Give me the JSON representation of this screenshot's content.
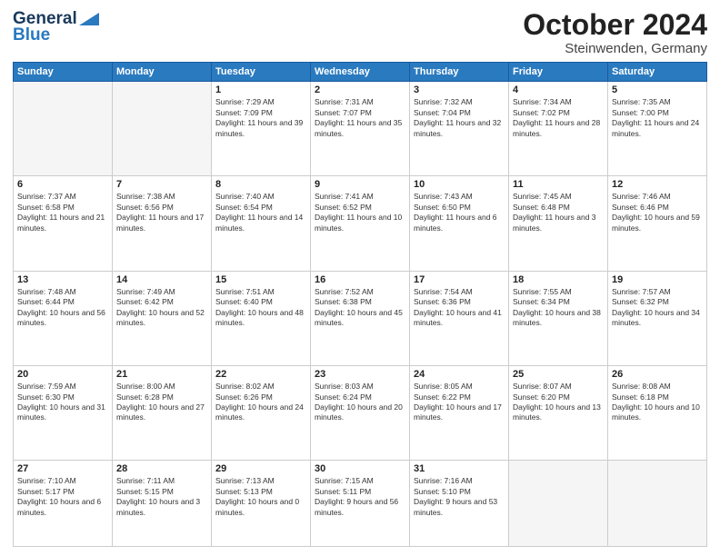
{
  "header": {
    "logo_line1": "General",
    "logo_line2": "Blue",
    "month": "October 2024",
    "location": "Steinwenden, Germany"
  },
  "days_of_week": [
    "Sunday",
    "Monday",
    "Tuesday",
    "Wednesday",
    "Thursday",
    "Friday",
    "Saturday"
  ],
  "weeks": [
    [
      {
        "day": "",
        "empty": true
      },
      {
        "day": "",
        "empty": true
      },
      {
        "day": "1",
        "sunrise": "Sunrise: 7:29 AM",
        "sunset": "Sunset: 7:09 PM",
        "daylight": "Daylight: 11 hours and 39 minutes."
      },
      {
        "day": "2",
        "sunrise": "Sunrise: 7:31 AM",
        "sunset": "Sunset: 7:07 PM",
        "daylight": "Daylight: 11 hours and 35 minutes."
      },
      {
        "day": "3",
        "sunrise": "Sunrise: 7:32 AM",
        "sunset": "Sunset: 7:04 PM",
        "daylight": "Daylight: 11 hours and 32 minutes."
      },
      {
        "day": "4",
        "sunrise": "Sunrise: 7:34 AM",
        "sunset": "Sunset: 7:02 PM",
        "daylight": "Daylight: 11 hours and 28 minutes."
      },
      {
        "day": "5",
        "sunrise": "Sunrise: 7:35 AM",
        "sunset": "Sunset: 7:00 PM",
        "daylight": "Daylight: 11 hours and 24 minutes."
      }
    ],
    [
      {
        "day": "6",
        "sunrise": "Sunrise: 7:37 AM",
        "sunset": "Sunset: 6:58 PM",
        "daylight": "Daylight: 11 hours and 21 minutes."
      },
      {
        "day": "7",
        "sunrise": "Sunrise: 7:38 AM",
        "sunset": "Sunset: 6:56 PM",
        "daylight": "Daylight: 11 hours and 17 minutes."
      },
      {
        "day": "8",
        "sunrise": "Sunrise: 7:40 AM",
        "sunset": "Sunset: 6:54 PM",
        "daylight": "Daylight: 11 hours and 14 minutes."
      },
      {
        "day": "9",
        "sunrise": "Sunrise: 7:41 AM",
        "sunset": "Sunset: 6:52 PM",
        "daylight": "Daylight: 11 hours and 10 minutes."
      },
      {
        "day": "10",
        "sunrise": "Sunrise: 7:43 AM",
        "sunset": "Sunset: 6:50 PM",
        "daylight": "Daylight: 11 hours and 6 minutes."
      },
      {
        "day": "11",
        "sunrise": "Sunrise: 7:45 AM",
        "sunset": "Sunset: 6:48 PM",
        "daylight": "Daylight: 11 hours and 3 minutes."
      },
      {
        "day": "12",
        "sunrise": "Sunrise: 7:46 AM",
        "sunset": "Sunset: 6:46 PM",
        "daylight": "Daylight: 10 hours and 59 minutes."
      }
    ],
    [
      {
        "day": "13",
        "sunrise": "Sunrise: 7:48 AM",
        "sunset": "Sunset: 6:44 PM",
        "daylight": "Daylight: 10 hours and 56 minutes."
      },
      {
        "day": "14",
        "sunrise": "Sunrise: 7:49 AM",
        "sunset": "Sunset: 6:42 PM",
        "daylight": "Daylight: 10 hours and 52 minutes."
      },
      {
        "day": "15",
        "sunrise": "Sunrise: 7:51 AM",
        "sunset": "Sunset: 6:40 PM",
        "daylight": "Daylight: 10 hours and 48 minutes."
      },
      {
        "day": "16",
        "sunrise": "Sunrise: 7:52 AM",
        "sunset": "Sunset: 6:38 PM",
        "daylight": "Daylight: 10 hours and 45 minutes."
      },
      {
        "day": "17",
        "sunrise": "Sunrise: 7:54 AM",
        "sunset": "Sunset: 6:36 PM",
        "daylight": "Daylight: 10 hours and 41 minutes."
      },
      {
        "day": "18",
        "sunrise": "Sunrise: 7:55 AM",
        "sunset": "Sunset: 6:34 PM",
        "daylight": "Daylight: 10 hours and 38 minutes."
      },
      {
        "day": "19",
        "sunrise": "Sunrise: 7:57 AM",
        "sunset": "Sunset: 6:32 PM",
        "daylight": "Daylight: 10 hours and 34 minutes."
      }
    ],
    [
      {
        "day": "20",
        "sunrise": "Sunrise: 7:59 AM",
        "sunset": "Sunset: 6:30 PM",
        "daylight": "Daylight: 10 hours and 31 minutes."
      },
      {
        "day": "21",
        "sunrise": "Sunrise: 8:00 AM",
        "sunset": "Sunset: 6:28 PM",
        "daylight": "Daylight: 10 hours and 27 minutes."
      },
      {
        "day": "22",
        "sunrise": "Sunrise: 8:02 AM",
        "sunset": "Sunset: 6:26 PM",
        "daylight": "Daylight: 10 hours and 24 minutes."
      },
      {
        "day": "23",
        "sunrise": "Sunrise: 8:03 AM",
        "sunset": "Sunset: 6:24 PM",
        "daylight": "Daylight: 10 hours and 20 minutes."
      },
      {
        "day": "24",
        "sunrise": "Sunrise: 8:05 AM",
        "sunset": "Sunset: 6:22 PM",
        "daylight": "Daylight: 10 hours and 17 minutes."
      },
      {
        "day": "25",
        "sunrise": "Sunrise: 8:07 AM",
        "sunset": "Sunset: 6:20 PM",
        "daylight": "Daylight: 10 hours and 13 minutes."
      },
      {
        "day": "26",
        "sunrise": "Sunrise: 8:08 AM",
        "sunset": "Sunset: 6:18 PM",
        "daylight": "Daylight: 10 hours and 10 minutes."
      }
    ],
    [
      {
        "day": "27",
        "sunrise": "Sunrise: 7:10 AM",
        "sunset": "Sunset: 5:17 PM",
        "daylight": "Daylight: 10 hours and 6 minutes."
      },
      {
        "day": "28",
        "sunrise": "Sunrise: 7:11 AM",
        "sunset": "Sunset: 5:15 PM",
        "daylight": "Daylight: 10 hours and 3 minutes."
      },
      {
        "day": "29",
        "sunrise": "Sunrise: 7:13 AM",
        "sunset": "Sunset: 5:13 PM",
        "daylight": "Daylight: 10 hours and 0 minutes."
      },
      {
        "day": "30",
        "sunrise": "Sunrise: 7:15 AM",
        "sunset": "Sunset: 5:11 PM",
        "daylight": "Daylight: 9 hours and 56 minutes."
      },
      {
        "day": "31",
        "sunrise": "Sunrise: 7:16 AM",
        "sunset": "Sunset: 5:10 PM",
        "daylight": "Daylight: 9 hours and 53 minutes."
      },
      {
        "day": "",
        "empty": true
      },
      {
        "day": "",
        "empty": true
      }
    ]
  ]
}
